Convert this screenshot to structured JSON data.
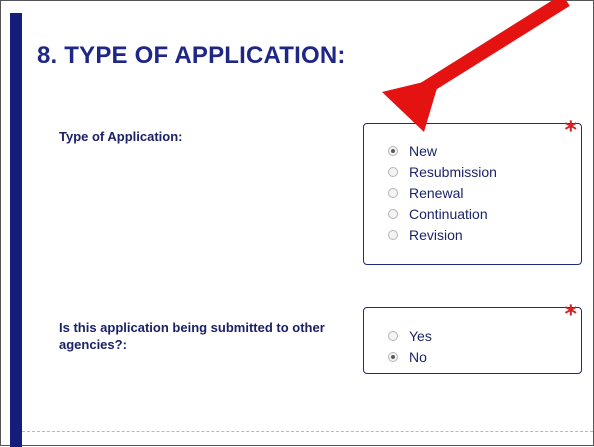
{
  "section": {
    "title": "8. TYPE OF APPLICATION:"
  },
  "type_of_application": {
    "label": "Type of Application:",
    "required_mark": "*",
    "options": [
      {
        "label": "New",
        "checked": true
      },
      {
        "label": "Resubmission",
        "checked": false
      },
      {
        "label": "Renewal",
        "checked": false
      },
      {
        "label": "Continuation",
        "checked": false
      },
      {
        "label": "Revision",
        "checked": false
      }
    ]
  },
  "other_agencies": {
    "label": "Is this application being submitted to other agencies?:",
    "required_mark": "*",
    "options": [
      {
        "label": "Yes",
        "checked": false
      },
      {
        "label": "No",
        "checked": true
      }
    ]
  },
  "colors": {
    "left_bar": "#141e7a",
    "title": "#1e2787",
    "required_mark": "#d42020",
    "annotation_arrow": "#e51212"
  },
  "icons": {
    "annotation": "red-arrow-icon",
    "required": "asterisk-icon"
  }
}
